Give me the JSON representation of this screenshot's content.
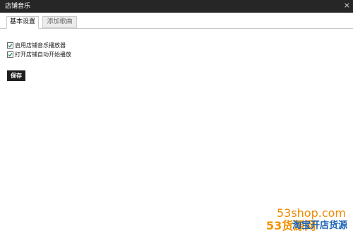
{
  "window": {
    "title": "店铺音乐",
    "close_glyph": "×"
  },
  "tabs": [
    {
      "label": "基本设置",
      "active": true
    },
    {
      "label": "添加歌曲",
      "active": false
    }
  ],
  "options": [
    {
      "label": "启用店铺音乐播放器",
      "checked": true
    },
    {
      "label": "打开店铺自动开始播放",
      "checked": true
    }
  ],
  "actions": {
    "save_label": "保存"
  },
  "watermark": {
    "url": "53shop.com",
    "name": "53货源网",
    "tagline": "淘宝开店货源",
    "colors": {
      "orange": "#f39200",
      "blue": "#1c63b7"
    }
  },
  "colors": {
    "titlebar": "#262626",
    "button": "#1f1f1f",
    "check": "#2e8b57"
  }
}
